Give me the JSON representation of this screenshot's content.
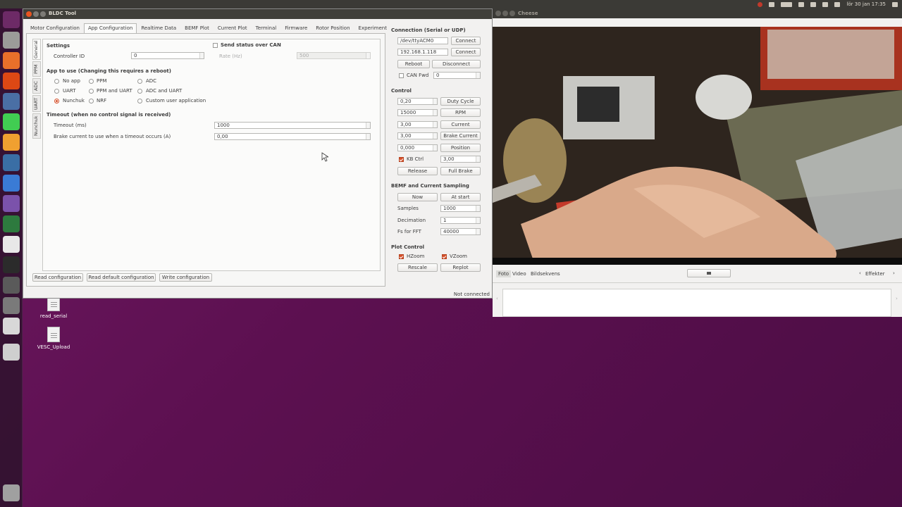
{
  "topbar": {
    "date_time": "lör 30 jan 17:35"
  },
  "desktop_icons": [
    {
      "label": "read_serial"
    },
    {
      "label": "VESC_Upload"
    }
  ],
  "bldc": {
    "title": "BLDC Tool",
    "tabs": [
      "Motor Configuration",
      "App Configuration",
      "Realtime Data",
      "BEMF Plot",
      "Current Plot",
      "Terminal",
      "Firmware",
      "Rotor Position",
      "Experiment"
    ],
    "side_tabs": [
      "General",
      "PPM",
      "ADC",
      "UART",
      "Nunchuk"
    ],
    "settings": {
      "header": "Settings",
      "controller_id_label": "Controller ID",
      "controller_id": "0",
      "send_status_label": "Send status over CAN",
      "rate_label": "Rate (Hz)",
      "rate": "500"
    },
    "app_to_use": {
      "header": "App to use (Changing this requires a reboot)",
      "options": [
        "No app",
        "PPM",
        "ADC",
        "UART",
        "PPM and UART",
        "ADC and UART",
        "Nunchuk",
        "NRF",
        "Custom user application"
      ],
      "selected": "Nunchuk"
    },
    "timeout": {
      "header": "Timeout (when no control signal is received)",
      "timeout_label": "Timeout (ms)",
      "timeout_value": "1000",
      "brake_label": "Brake current to use when a timeout occurs (A)",
      "brake_value": "0,00"
    },
    "bottom_buttons": [
      "Read configuration",
      "Read default configuration",
      "Write configuration"
    ],
    "connection": {
      "header": "Connection (Serial or UDP)",
      "serial_port": "/dev/ttyACM0",
      "ip": "192.168.1.118",
      "connect": "Connect",
      "reboot": "Reboot",
      "disconnect": "Disconnect",
      "can_fwd_label": "CAN Fwd",
      "can_fwd_value": "0"
    },
    "control": {
      "header": "Control",
      "rows": [
        {
          "value": "0,20",
          "button": "Duty Cycle"
        },
        {
          "value": "15000",
          "button": "RPM"
        },
        {
          "value": "3,00",
          "button": "Current"
        },
        {
          "value": "3,00",
          "button": "Brake Current"
        },
        {
          "value": "0,000",
          "button": "Position"
        }
      ],
      "kb_ctrl_label": "KB Ctrl",
      "kb_ctrl_value": "3,00",
      "release": "Release",
      "full_brake": "Full Brake"
    },
    "bemf": {
      "header": "BEMF and Current Sampling",
      "now": "Now",
      "at_start": "At start",
      "samples_label": "Samples",
      "samples": "1000",
      "decimation_label": "Decimation",
      "decimation": "1",
      "fs_label": "Fs for FFT",
      "fs": "40000"
    },
    "plot_control": {
      "header": "Plot Control",
      "hzoom": "HZoom",
      "vzoom": "VZoom",
      "rescale": "Rescale",
      "replot": "Replot"
    },
    "status": "Not connected"
  },
  "cheese": {
    "title": "Cheese",
    "modes": [
      "Foto",
      "Video",
      "Bildsekvens"
    ],
    "effects": "Effekter"
  }
}
